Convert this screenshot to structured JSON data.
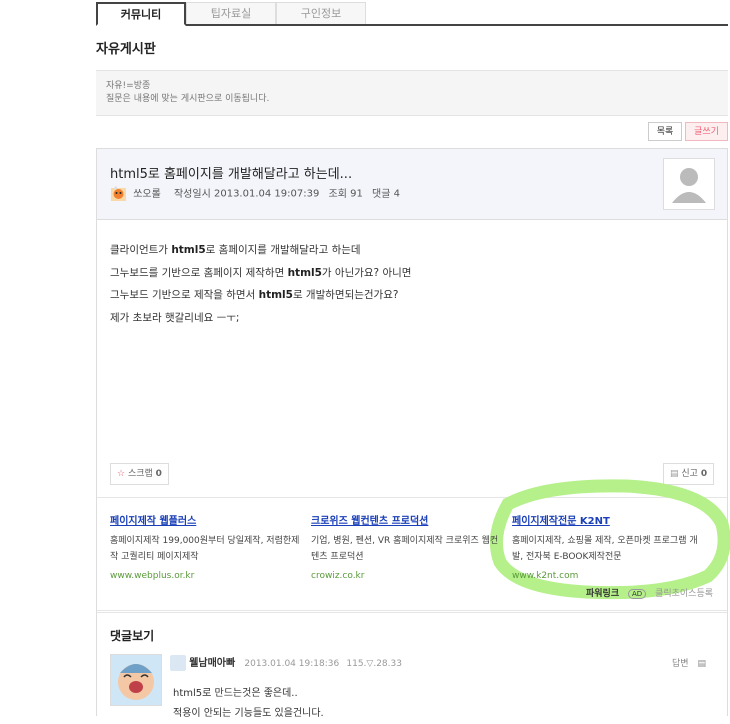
{
  "tabs": [
    {
      "label": "커뮤니티",
      "active": true
    },
    {
      "label": "팁자료실",
      "active": false
    },
    {
      "label": "구인정보",
      "active": false
    }
  ],
  "board_title": "자유게시판",
  "description": {
    "line1": "자유!=방종",
    "line2": "질문은 내용에 맞는 게시판으로 이동됩니다."
  },
  "buttons": {
    "list": "목록",
    "write": "글쓰기"
  },
  "post": {
    "title": "html5로 홈페이지를 개발해달라고 하는데...",
    "author": "쏘오롤",
    "date_label": "작성일시",
    "date": "2013.01.04 19:07:39",
    "views_label": "조회",
    "views": "91",
    "comments_label": "댓글",
    "comments": "4",
    "body": [
      [
        {
          "t": "클라이언트가 "
        },
        {
          "t": "html5",
          "b": true
        },
        {
          "t": "로 홈페이지를 개발해달라고 하는데"
        }
      ],
      [
        {
          "t": "그누보드를 기반으로 홈페이지 제작하면 "
        },
        {
          "t": "html5",
          "b": true
        },
        {
          "t": "가 아닌가요? 아니면"
        }
      ],
      [
        {
          "t": "그누보드 기반으로 제작을 하면서 "
        },
        {
          "t": "html5",
          "b": true
        },
        {
          "t": "로 개발하면되는건가요?"
        }
      ],
      [
        {
          "t": "제가 초보라 햇갈리네요 ㅡㅜ;"
        }
      ]
    ],
    "scrap_label": "스크랩",
    "scrap_count": "0",
    "report_label": "신고",
    "report_count": "0"
  },
  "ads": [
    {
      "title": "페이지제작 웹플러스",
      "desc": "홈페이지제작 199,000원부터 당일제작, 저렴한제작 고퀄리티 페이지제작",
      "url": "www.webplus.or.kr"
    },
    {
      "title": "크로위즈 웹컨텐츠 프로덕션",
      "desc": "기업, 병원, 펜션, VR 홈페이지제작 크로위즈 웹컨텐츠 프로덕션",
      "url": "crowiz.co.kr"
    },
    {
      "title": "페이지제작전문 K2NT",
      "desc": "홈페이지제작, 쇼핑몰 제작, 오픈마켓 프로그램 개발, 전자북 E-BOOK제작전문",
      "url": "www.k2nt.com"
    }
  ],
  "powerlink": {
    "label": "파워링크",
    "ad_badge": "AD",
    "register": "클릭초이스등록"
  },
  "comments": {
    "title": "댓글보기",
    "items": [
      {
        "author": "웰남매아빠",
        "date": "2013.01.04 19:18:36",
        "info": "115.▽.28.33",
        "reply": "답변",
        "lines": [
          "html5로 만드는것은 좋은데..",
          "적용이 안되는 기능들도 있을건니다."
        ]
      }
    ]
  },
  "colors": {
    "accent_green": "#b5f08a",
    "link_blue": "#1a3fb8",
    "write_pink": "#ee6677"
  }
}
